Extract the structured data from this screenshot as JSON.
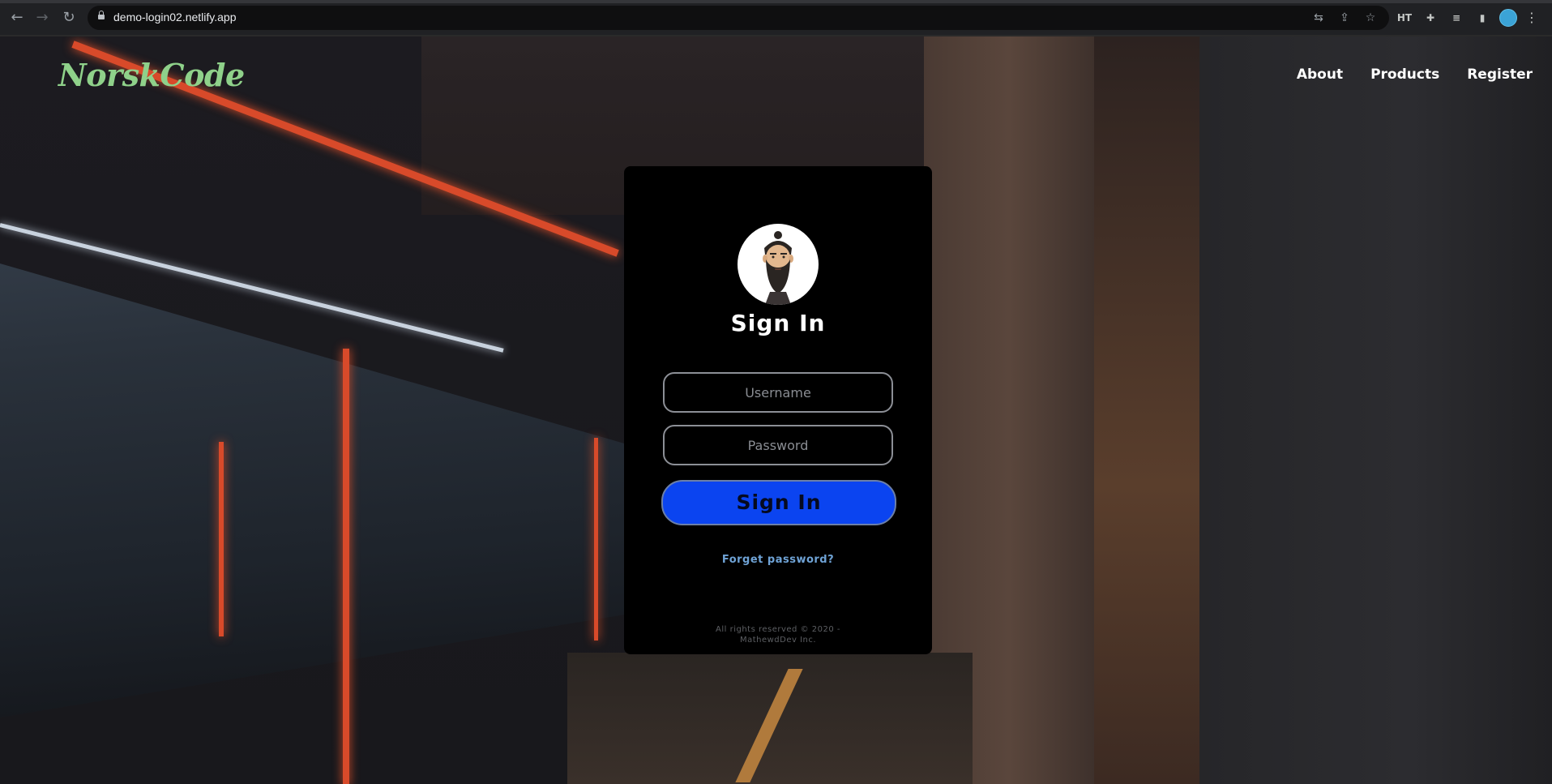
{
  "browser": {
    "url": "demo-login02.netlify.app",
    "ext_label": "HT"
  },
  "site": {
    "logo": "NorskCode",
    "nav": [
      "About",
      "Products",
      "Register"
    ]
  },
  "login": {
    "title": "Sign In",
    "username_placeholder": "Username",
    "password_placeholder": "Password",
    "submit_label": "Sign In",
    "forgot_label": "Forget password?",
    "footer_line1": "All rights reserved © 2020 -",
    "footer_line2": "MathewdDev Inc."
  },
  "colors": {
    "logo": "#8fd18a",
    "button": "#0b44f0",
    "link": "#6fa3d6"
  }
}
